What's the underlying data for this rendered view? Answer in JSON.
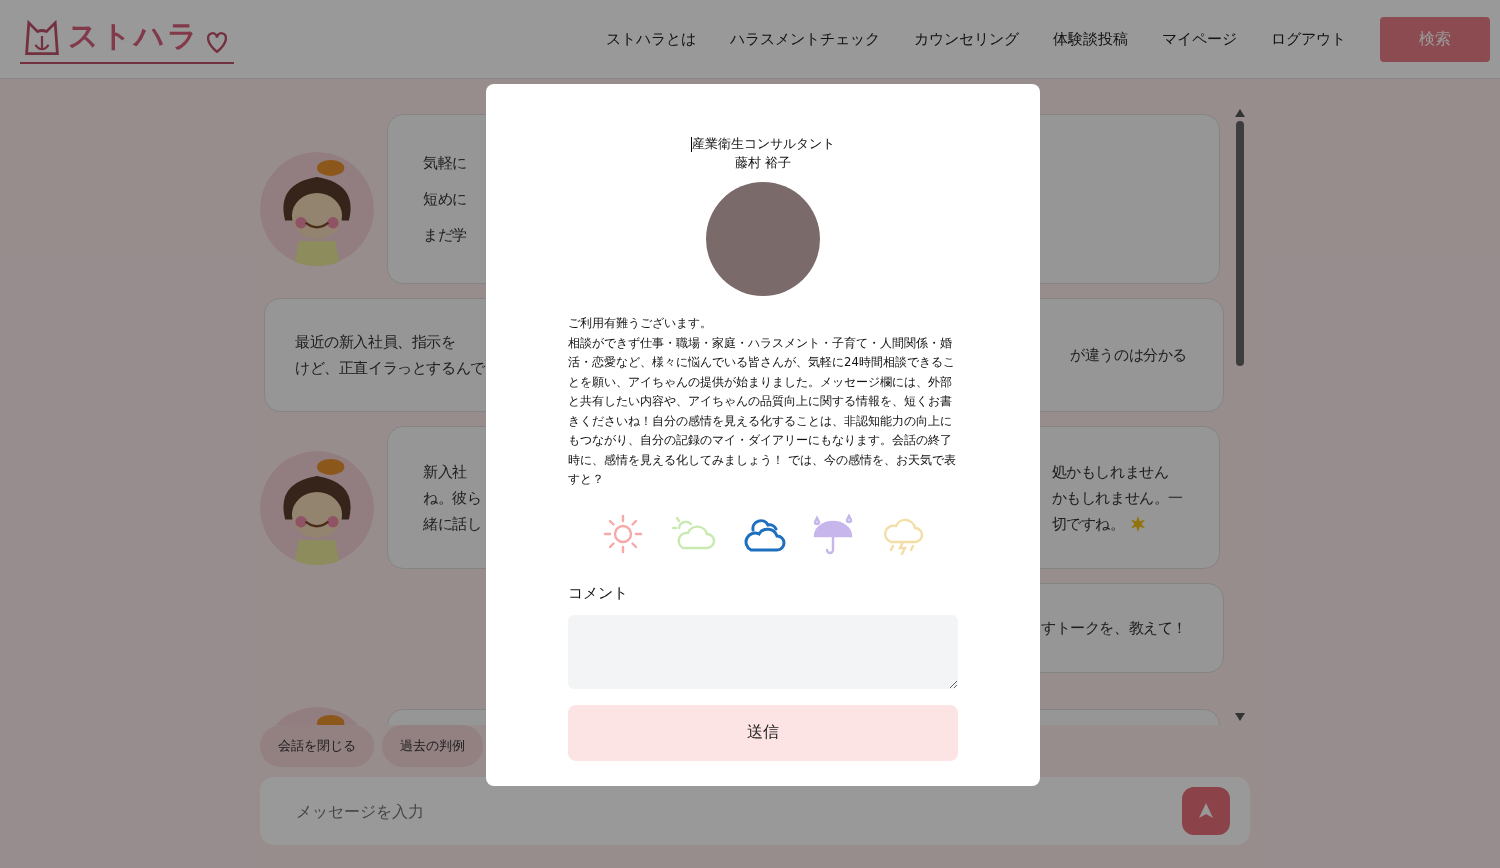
{
  "header": {
    "logo": "ストハラ",
    "nav": [
      {
        "label": "ストハラとは"
      },
      {
        "label": "ハラスメントチェック"
      },
      {
        "label": "カウンセリング"
      },
      {
        "label": "体験談投稿"
      },
      {
        "label": "マイページ"
      },
      {
        "label": "ログアウト"
      }
    ],
    "search_button": "検索"
  },
  "chat": {
    "messages": [
      {
        "kind": "bot",
        "lines_left": [
          "気軽に",
          "短めに",
          "まだ学"
        ]
      },
      {
        "kind": "user",
        "lines_left": [
          "最近の新入社員、指示を",
          "けど、正直イラっとするんで"
        ],
        "lines_right": [
          "が違うのは分かる"
        ]
      },
      {
        "kind": "bot",
        "lines_left": [
          "新入社",
          "ね。彼ら",
          "緒に話し"
        ],
        "lines_right": [
          "処かもしれません",
          "かもしれません。一",
          "切ですね。"
        ],
        "sparkle": true
      },
      {
        "kind": "user",
        "lines_right": [
          "すトークを、教えて！"
        ]
      },
      {
        "kind": "bot"
      }
    ]
  },
  "quick_actions": [
    {
      "label": "会話を閉じる"
    },
    {
      "label": "過去の判例"
    }
  ],
  "message_input": {
    "placeholder": "メッセージを入力"
  },
  "modal": {
    "role": "産業衛生コンサルタント",
    "name": "藤村 裕子",
    "paragraphs": [
      "ご利用有難うございます。",
      "相談ができず仕事・職場・家庭・ハラスメント・子育て・人間関係・婚活・恋愛など、様々に悩んでいる皆さんが、気軽に24時間相談できることを願い、アイちゃんの提供が始まりました。メッセージ欄には、外部と共有したい内容や、アイちゃんの品質向上に関する情報を、短くお書きくださいね！自分の感情を見える化することは、非認知能力の向上にもつながり、自分の記録のマイ・ダイアリーにもなります。会話の終了時に、感情を見える化してみましょう！ では、今の感情を、お天気で表すと？"
    ],
    "weather": [
      {
        "kind": "sunny",
        "selected": false
      },
      {
        "kind": "partly_cloudy",
        "selected": false
      },
      {
        "kind": "cloudy",
        "selected": true
      },
      {
        "kind": "rainy",
        "selected": false
      },
      {
        "kind": "stormy",
        "selected": false
      }
    ],
    "comment_label": "コメント",
    "submit_button": "送信"
  }
}
